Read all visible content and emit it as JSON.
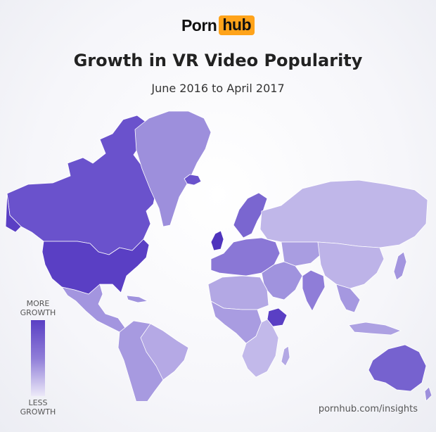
{
  "brand": {
    "part1": "Porn",
    "part2": "hub"
  },
  "title": "Growth in VR Video Popularity",
  "subtitle": "June 2016 to April 2017",
  "legend": {
    "top_line1": "MORE",
    "top_line2": "GROWTH",
    "bottom_line1": "LESS",
    "bottom_line2": "GROWTH",
    "color_high": "#5a3fc4",
    "color_mid": "#8f7dd8",
    "color_low": "#ece9f8"
  },
  "source": "pornhub.com/insights",
  "map_regions": [
    {
      "name": "Canada",
      "growth": "high",
      "color": "#6a52cc"
    },
    {
      "name": "United States",
      "growth": "high",
      "color": "#5a3fc4"
    },
    {
      "name": "Greenland",
      "growth": "medium",
      "color": "#9d8fdc"
    },
    {
      "name": "Mexico",
      "growth": "medium",
      "color": "#a395df"
    },
    {
      "name": "South America",
      "growth": "medium",
      "color": "#a79ae0"
    },
    {
      "name": "United Kingdom",
      "growth": "high",
      "color": "#4f34bd"
    },
    {
      "name": "Europe",
      "growth": "medium-high",
      "color": "#8a77d6"
    },
    {
      "name": "Scandinavia",
      "growth": "medium-high",
      "color": "#7a66d0"
    },
    {
      "name": "Russia",
      "growth": "low",
      "color": "#c0b7e9"
    },
    {
      "name": "Africa",
      "growth": "medium-low",
      "color": "#b3a8e4"
    },
    {
      "name": "Ethiopia",
      "growth": "high",
      "color": "#5a3fc4"
    },
    {
      "name": "Middle East",
      "growth": "medium",
      "color": "#a093de"
    },
    {
      "name": "India",
      "growth": "medium-high",
      "color": "#8f7dd8"
    },
    {
      "name": "China",
      "growth": "low",
      "color": "#bdb3e8"
    },
    {
      "name": "Southeast Asia",
      "growth": "medium",
      "color": "#a598e0"
    },
    {
      "name": "Australia",
      "growth": "high",
      "color": "#7662cf"
    }
  ]
}
